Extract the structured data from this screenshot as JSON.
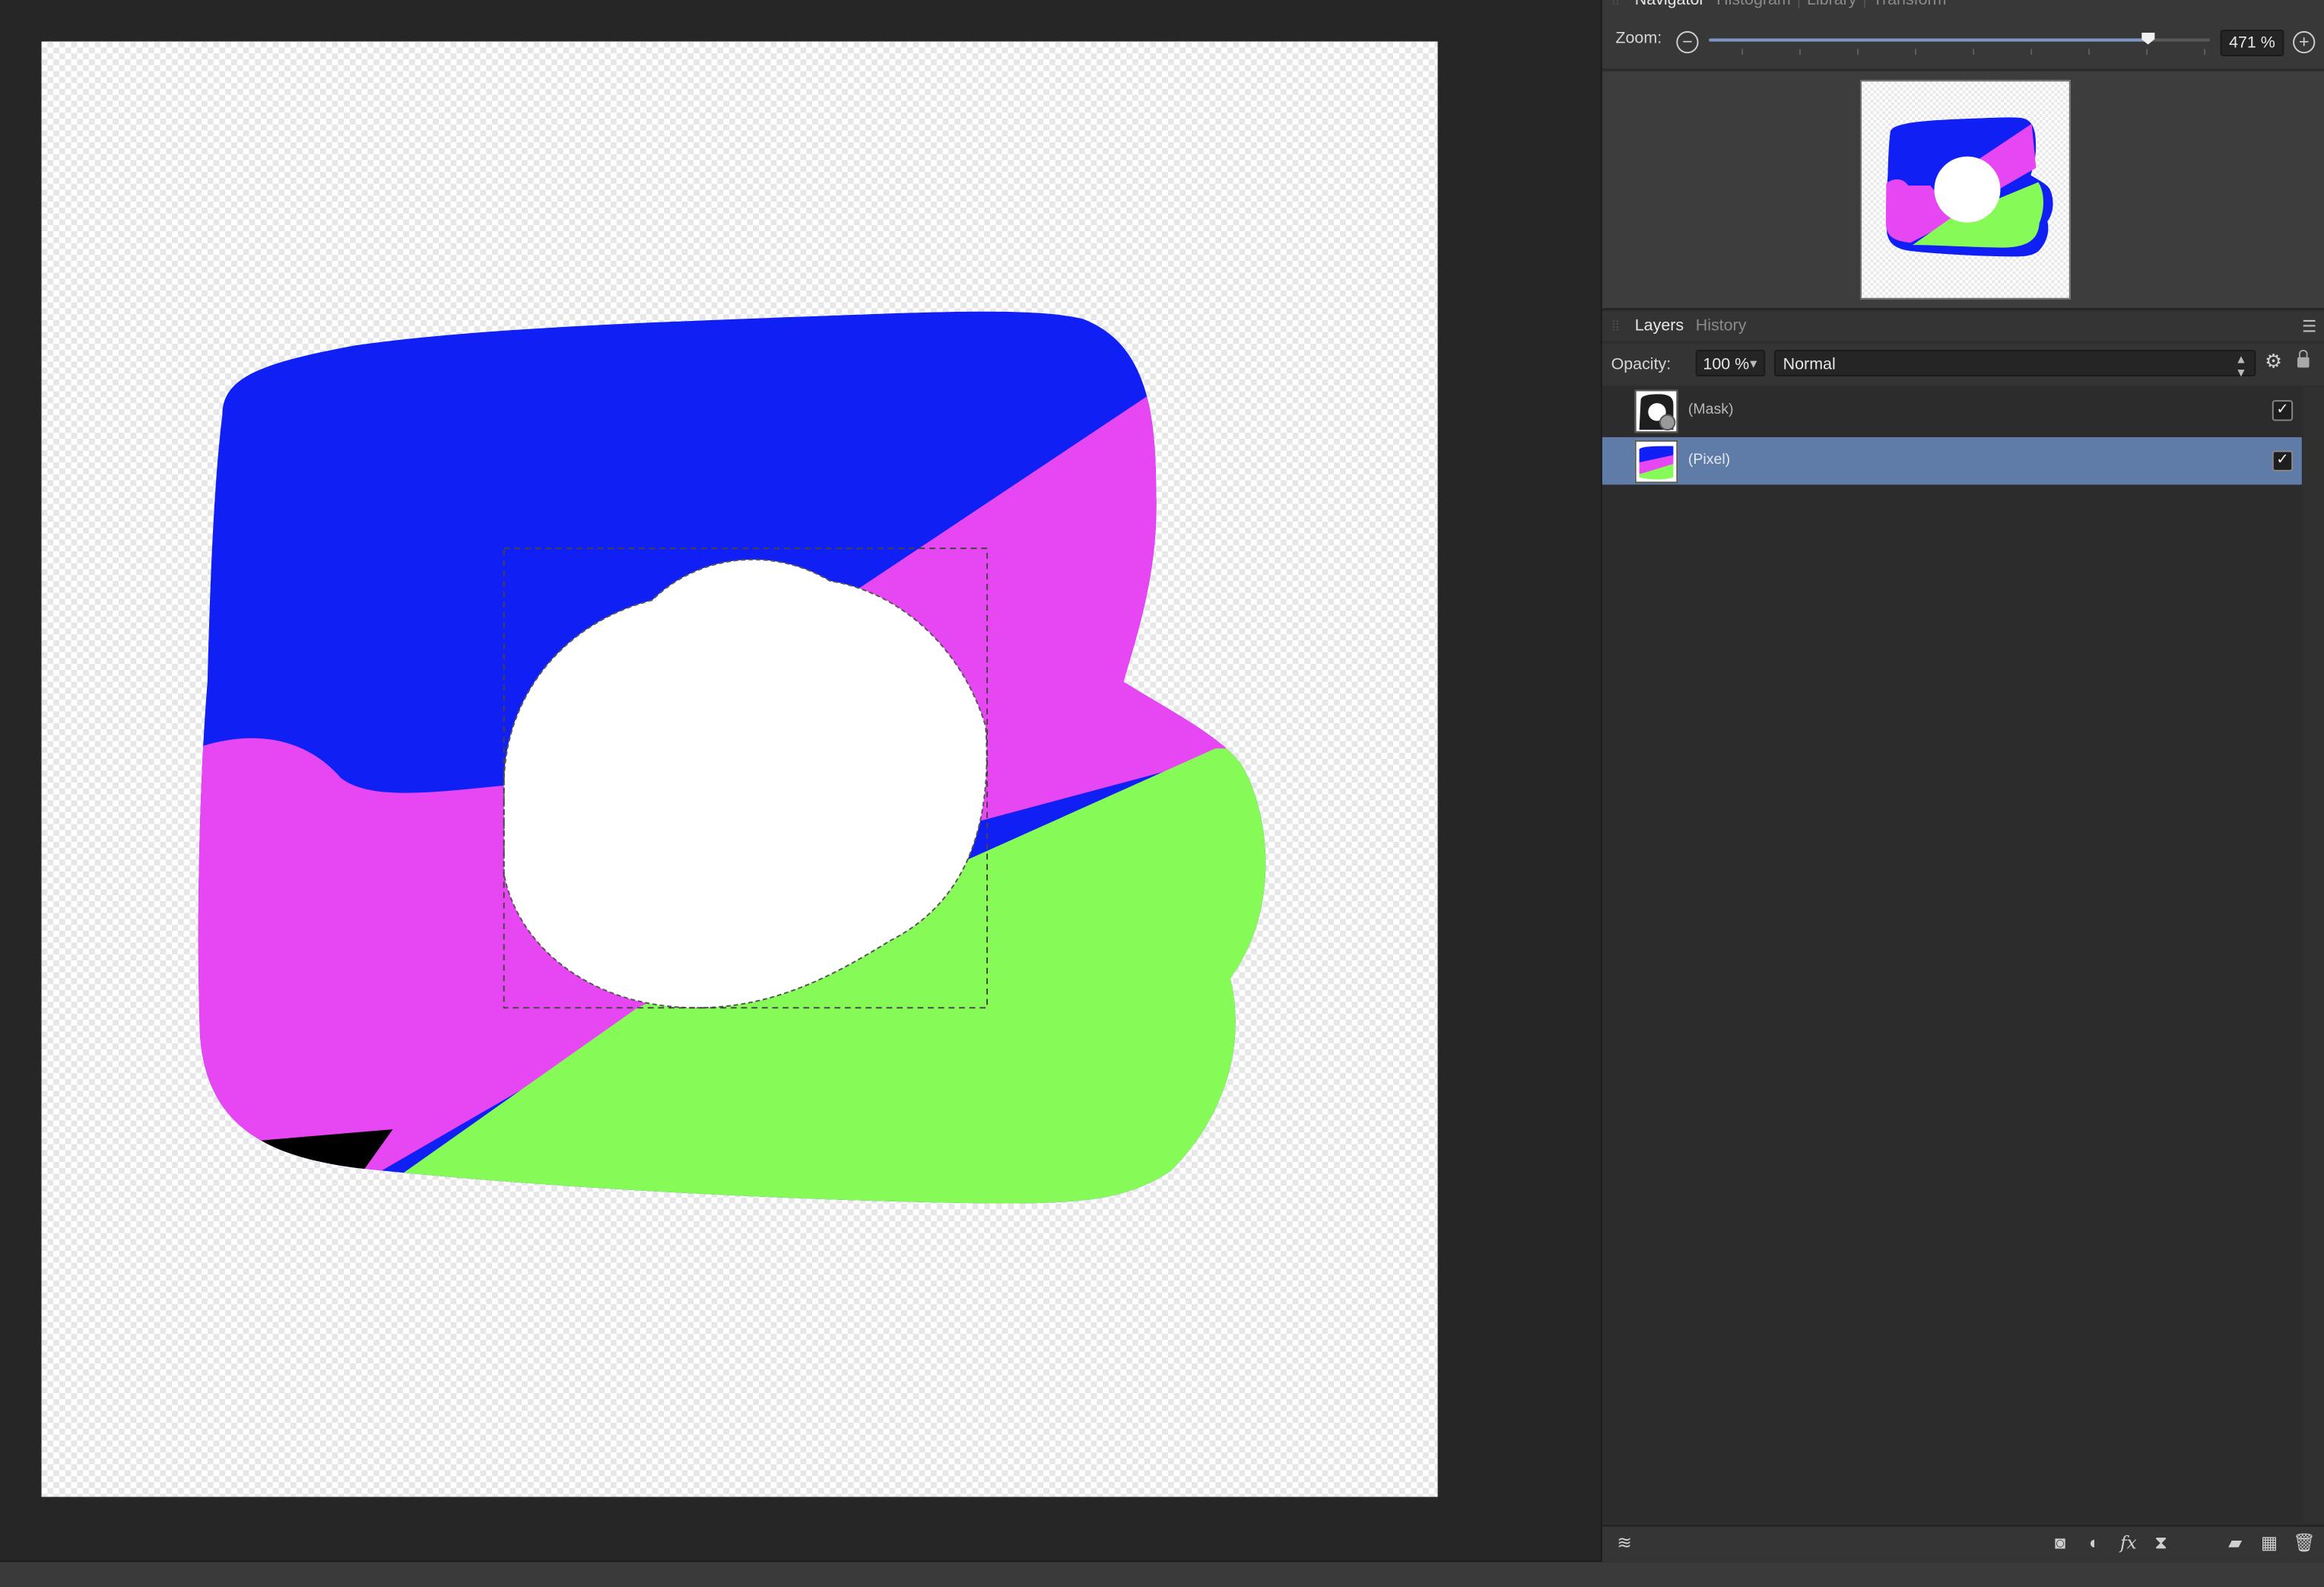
{
  "navigator_panel": {
    "tabs": [
      "Navigator",
      "Histogram",
      "Library",
      "Transform"
    ],
    "active_tab": "Navigator",
    "zoom_label": "Zoom:",
    "zoom_value": "471 %",
    "zoom_slider_level": 0.875,
    "minus_icon": "zoom-out-icon",
    "plus_icon": "zoom-in-icon"
  },
  "layers_panel": {
    "tabs": [
      "Layers",
      "History"
    ],
    "active_tab": "Layers",
    "opacity_label": "Opacity:",
    "opacity_value": "100 %",
    "blend_mode": "Normal",
    "layers": [
      {
        "name": "(Mask)",
        "visible": true,
        "selected": false
      },
      {
        "name": "(Pixel)",
        "visible": true,
        "selected": true
      }
    ],
    "bottom_icons": [
      "layer-stack-icon",
      "mask-icon",
      "adjustment-icon",
      "fx-icon",
      "live-filter-icon",
      "group-icon",
      "pixel-layer-icon",
      "trash-icon"
    ]
  },
  "document": {
    "colors": {
      "blue": "#1020f5",
      "magenta": "#e746f3",
      "green": "#86fb57",
      "black": "#000000"
    },
    "selection": "marching-ants-rectangle"
  },
  "checkmark": "✓"
}
